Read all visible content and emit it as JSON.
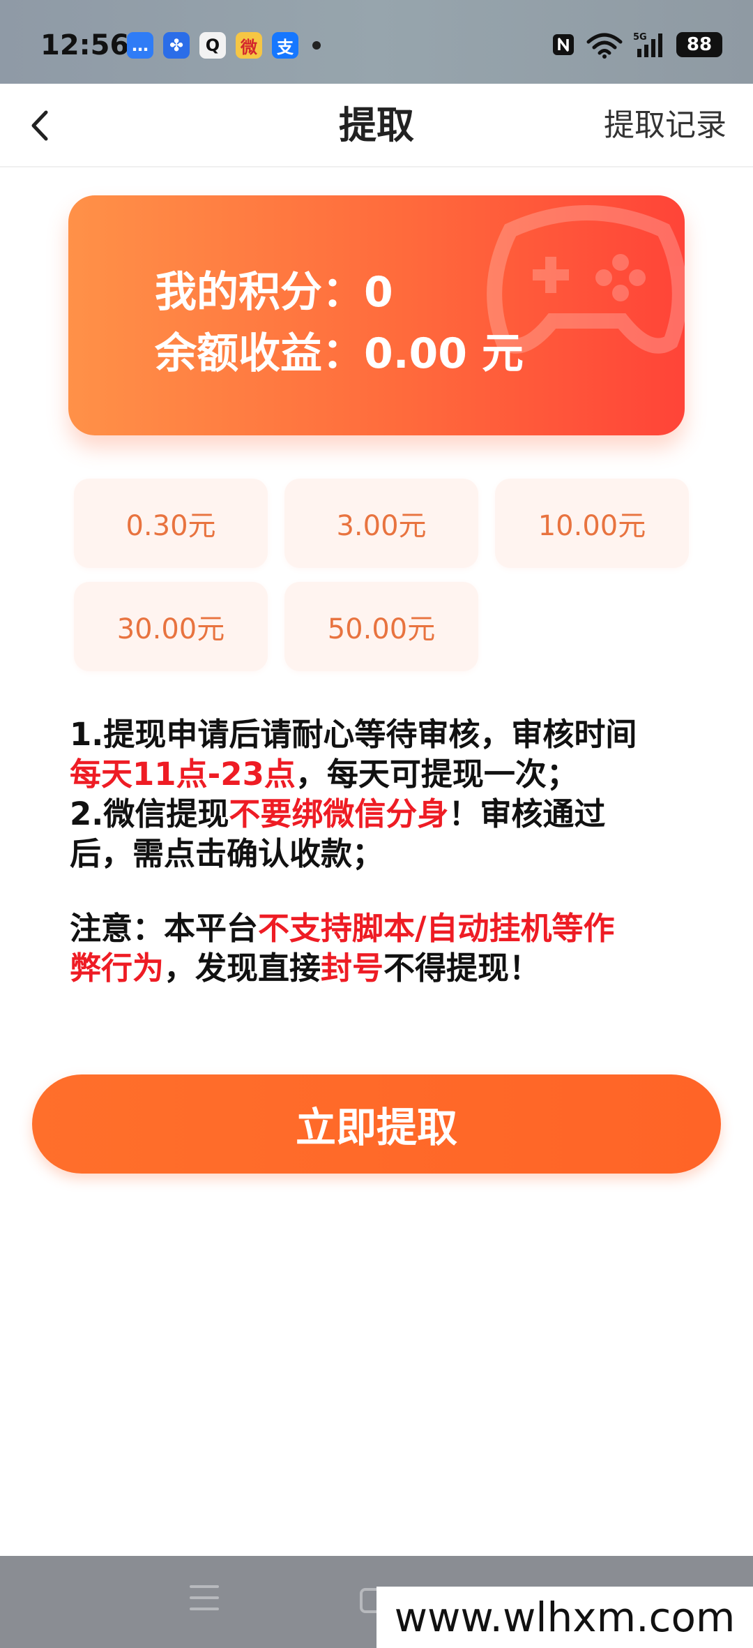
{
  "status_bar": {
    "time": "12:56",
    "apps": [
      {
        "name": "messages-app-icon",
        "glyph": "…",
        "color": "#2f7cf6"
      },
      {
        "name": "pinwheel-app-icon",
        "glyph": "✤",
        "color": "#2b6de8"
      },
      {
        "name": "qq-app-icon",
        "glyph": "Q",
        "color": "#f2f2f2"
      },
      {
        "name": "weibo-app-icon",
        "glyph": "微",
        "color": "#f6c644"
      },
      {
        "name": "alipay-app-icon",
        "glyph": "支",
        "color": "#1677ff"
      }
    ],
    "battery": "88"
  },
  "header": {
    "title": "提取",
    "records_label": "提取记录"
  },
  "card": {
    "points_label": "我的积分：",
    "points_value": "0",
    "balance_label": "余额收益：",
    "balance_value": "0.00 元"
  },
  "amounts": [
    "0.30元",
    "3.00元",
    "10.00元",
    "30.00元",
    "50.00元"
  ],
  "notes": {
    "l1_a": "1.提现申请后请耐心等待审核，审核时间",
    "l2_red": "每天11点-23点",
    "l2_b": "，每天可提现一次；",
    "l3_a": "2.微信提现",
    "l3_red": "不要绑微信分身",
    "l3_b": "！审核通过",
    "l4": "后，需点击确认收款；",
    "l5_a": "注意：本平台",
    "l5_red": "不支持脚本/自动挂机等作",
    "l6_red": "弊行为",
    "l6_b": "，发现直接",
    "l6_red2": "封号",
    "l6_c": "不得提现！"
  },
  "submit_label": "立即提取",
  "watermark": "www.wlhxm.com",
  "colors": {
    "accent": "#ff6a2b",
    "highlight_red": "#ee1c24",
    "amount_text": "#e8733f"
  }
}
